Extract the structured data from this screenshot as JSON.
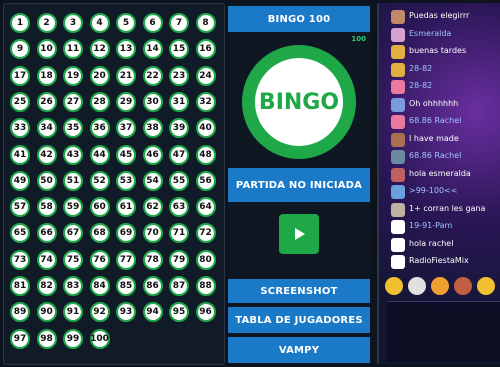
{
  "board": {
    "numbers": [
      "1",
      "2",
      "3",
      "4",
      "5",
      "6",
      "7",
      "8",
      "9",
      "10",
      "11",
      "12",
      "13",
      "14",
      "15",
      "16",
      "17",
      "18",
      "19",
      "20",
      "21",
      "22",
      "23",
      "24",
      "25",
      "26",
      "27",
      "28",
      "29",
      "30",
      "31",
      "32",
      "33",
      "34",
      "35",
      "36",
      "37",
      "38",
      "39",
      "40",
      "41",
      "42",
      "43",
      "44",
      "45",
      "46",
      "47",
      "48",
      "49",
      "50",
      "51",
      "52",
      "53",
      "54",
      "55",
      "56",
      "57",
      "58",
      "59",
      "60",
      "61",
      "62",
      "63",
      "64",
      "65",
      "66",
      "67",
      "68",
      "69",
      "70",
      "71",
      "72",
      "73",
      "74",
      "75",
      "76",
      "77",
      "78",
      "79",
      "80",
      "81",
      "82",
      "83",
      "84",
      "85",
      "86",
      "87",
      "88",
      "89",
      "90",
      "91",
      "92",
      "93",
      "94",
      "95",
      "96",
      "97",
      "98",
      "99",
      "100"
    ]
  },
  "center": {
    "title_button": "BINGO 100",
    "count": "100",
    "logo_text": "BINGO",
    "status_button": "PARTIDA NO INICIADA",
    "screenshot_button": "SCREENSHOT",
    "players_button": "TABLA DE JUGADORES",
    "vampy_button": "VAMPY",
    "colors": {
      "accent_blue": "#1a7ac8",
      "green": "#1ea847"
    }
  },
  "chat": {
    "messages": [
      {
        "text": "Puedas elegirrr",
        "type": "text"
      },
      {
        "text": "Esmeralda",
        "type": "name"
      },
      {
        "text": "buenas tardes",
        "type": "text"
      },
      {
        "text": "28-82",
        "type": "name"
      },
      {
        "text": "28-82",
        "type": "name"
      },
      {
        "text": "Oh ohhhhhh",
        "type": "text"
      },
      {
        "text": "68.86 Rachel",
        "type": "name"
      },
      {
        "text": "I have made",
        "type": "text"
      },
      {
        "text": "68.86 Rachel",
        "type": "name"
      },
      {
        "text": "hola esmeralda",
        "type": "text"
      },
      {
        "text": ">99-100<<",
        "type": "name"
      },
      {
        "text": "1+ corran les gana",
        "type": "text"
      },
      {
        "text": "19-91-Pam",
        "type": "name"
      },
      {
        "text": "hola rachel",
        "type": "text"
      },
      {
        "text": "RadioFiestaMix",
        "type": "text"
      }
    ]
  }
}
